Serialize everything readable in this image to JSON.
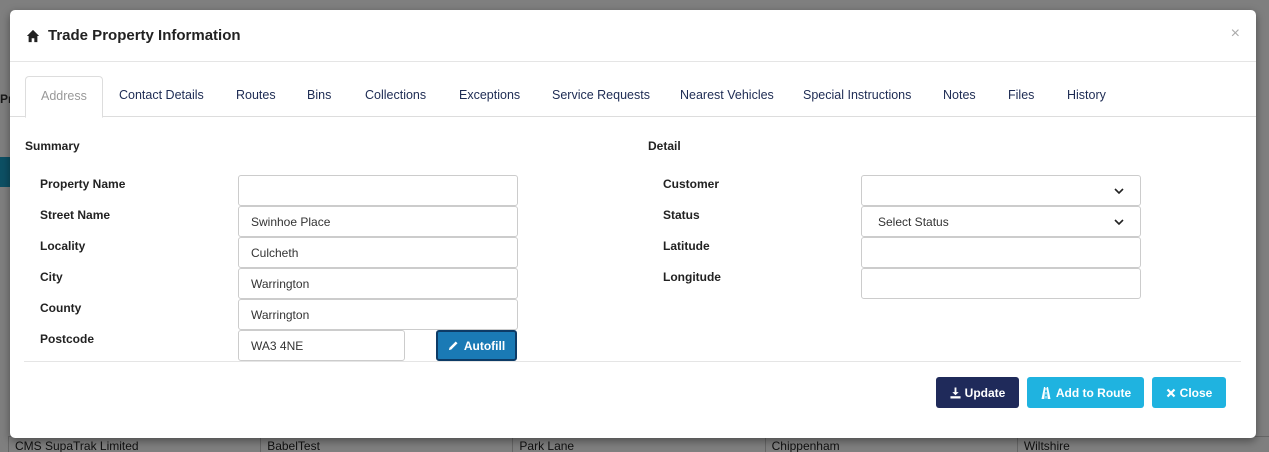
{
  "background": {
    "left_text": "Pr",
    "row_cells": [
      "CMS SupaTrak Limited",
      "BabelTest",
      "Park Lane",
      "Chippenham",
      "Wiltshire"
    ]
  },
  "modal": {
    "title": "Trade Property Information",
    "close_symbol": "×",
    "header_icon": "home-icon"
  },
  "tabs": [
    {
      "label": "Address",
      "active": true
    },
    {
      "label": "Contact Details"
    },
    {
      "label": "Routes"
    },
    {
      "label": "Bins"
    },
    {
      "label": "Collections"
    },
    {
      "label": "Exceptions"
    },
    {
      "label": "Service Requests"
    },
    {
      "label": "Nearest Vehicles"
    },
    {
      "label": "Special Instructions"
    },
    {
      "label": "Notes"
    },
    {
      "label": "Files"
    },
    {
      "label": "History"
    }
  ],
  "summary": {
    "title": "Summary",
    "fields": [
      {
        "label": "Property Name",
        "value": ""
      },
      {
        "label": "Street Name",
        "value": "Swinhoe Place"
      },
      {
        "label": "Locality",
        "value": "Culcheth"
      },
      {
        "label": "City",
        "value": "Warrington"
      },
      {
        "label": "County",
        "value": "Warrington"
      },
      {
        "label": "Postcode",
        "value": "WA3 4NE"
      }
    ],
    "autofill_label": "Autofill"
  },
  "detail": {
    "title": "Detail",
    "customer": {
      "label": "Customer",
      "selected": ""
    },
    "status": {
      "label": "Status",
      "selected": "Select Status"
    },
    "latitude": {
      "label": "Latitude",
      "value": ""
    },
    "longitude": {
      "label": "Longitude",
      "value": ""
    }
  },
  "footer": {
    "update_label": "Update",
    "add_route_label": "Add to Route",
    "close_label": "Close"
  },
  "colors": {
    "update": "#1f2a5a",
    "accent": "#1fb3e0",
    "autofill": "#1a7ab5"
  }
}
